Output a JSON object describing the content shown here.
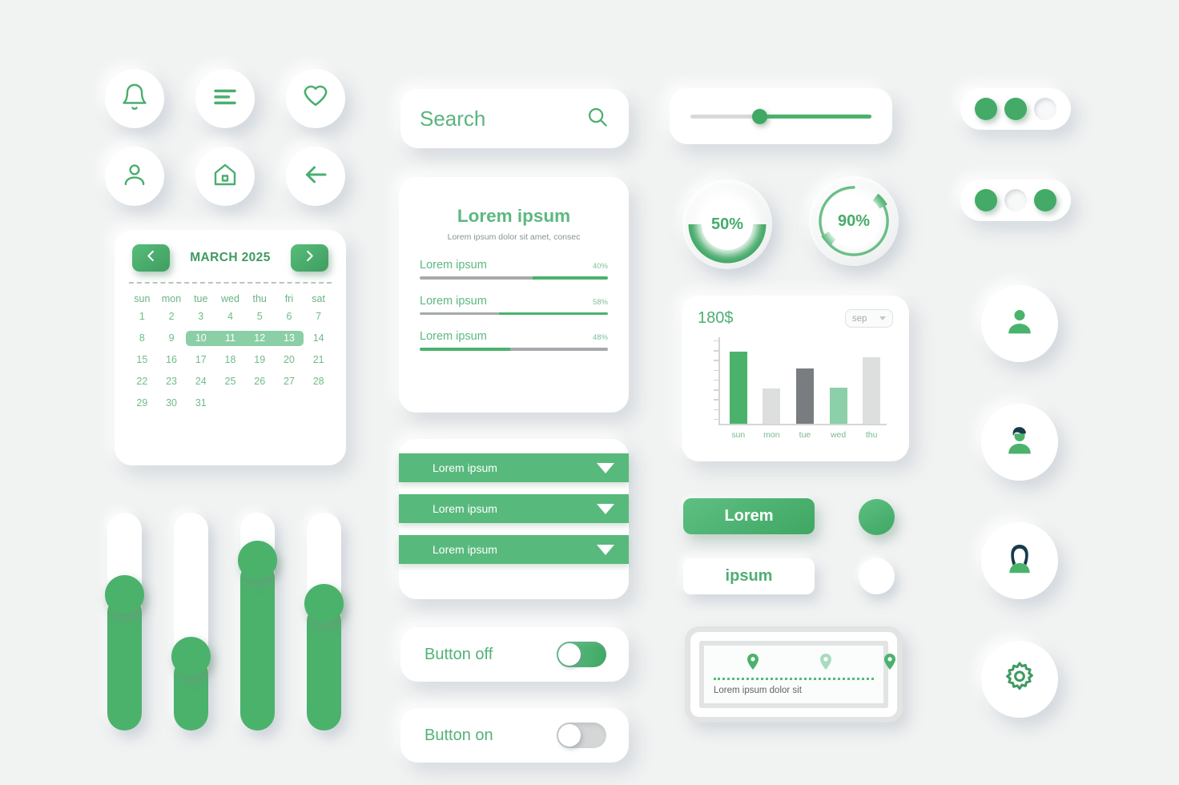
{
  "theme": {
    "background": "#f1f2f2",
    "green": "#4bb26c",
    "green_dark": "#3fa662",
    "green_light": "#8bcfa6",
    "gray": "#a7a9ac",
    "gray_dark": "#7a7d80",
    "gray_light": "#dddede",
    "text_green": "#53b277"
  },
  "icon_buttons": [
    {
      "name": "bell-icon",
      "label": "Notifications"
    },
    {
      "name": "menu-icon",
      "label": "Menu"
    },
    {
      "name": "heart-icon",
      "label": "Favorites"
    },
    {
      "name": "user-icon",
      "label": "Profile"
    },
    {
      "name": "home-icon",
      "label": "Home"
    },
    {
      "name": "back-arrow-icon",
      "label": "Back"
    }
  ],
  "calendar": {
    "title": "MARCH 2025",
    "prev_label": "<",
    "next_label": ">",
    "day_names": [
      "sun",
      "mon",
      "tue",
      "wed",
      "thu",
      "fri",
      "sat"
    ],
    "weeks": [
      [
        "1",
        "2",
        "3",
        "4",
        "5",
        "6",
        "7"
      ],
      [
        "8",
        "9",
        "10",
        "11",
        "12",
        "13",
        "14"
      ],
      [
        "15",
        "16",
        "17",
        "18",
        "19",
        "20",
        "21"
      ],
      [
        "22",
        "23",
        "24",
        "25",
        "26",
        "27",
        "28"
      ],
      [
        "29",
        "30",
        "31",
        "",
        "",
        "",
        ""
      ]
    ],
    "selected_range": [
      "10",
      "11",
      "12",
      "13"
    ],
    "selected_row_index": 1,
    "selected_col_start": 2,
    "selected_col_end": 5
  },
  "vertical_sliders": [
    {
      "name": "slider-1",
      "value": 62
    },
    {
      "name": "slider-2",
      "value": 34
    },
    {
      "name": "slider-3",
      "value": 78
    },
    {
      "name": "slider-4",
      "value": 58
    }
  ],
  "search": {
    "placeholder": "Search",
    "value": "Search",
    "icon": "search-icon"
  },
  "stats_card": {
    "title": "Lorem ipsum",
    "subtitle": "Lorem ipsum dolor sit amet, consec",
    "items": [
      {
        "label": "Lorem ipsum",
        "percent": "40%",
        "value": 40,
        "fill_from": "right"
      },
      {
        "label": "Lorem ipsum",
        "percent": "58%",
        "value": 58,
        "fill_from": "right"
      },
      {
        "label": "Lorem ipsum",
        "percent": "48%",
        "value": 48,
        "fill_from": "left"
      }
    ]
  },
  "dropdowns": [
    {
      "label": "Lorem ipsum",
      "icon": "chevron-down-icon"
    },
    {
      "label": "Lorem ipsum",
      "icon": "chevron-down-icon"
    },
    {
      "label": "Lorem ipsum",
      "icon": "chevron-down-icon"
    }
  ],
  "toggles": [
    {
      "label": "Button off",
      "state": "on"
    },
    {
      "label": "Button on",
      "state": "off"
    }
  ],
  "horizontal_slider": {
    "value": 38
  },
  "gauges": [
    {
      "name": "gauge-50",
      "label": "50%",
      "value": 50,
      "style": "thick-arc"
    },
    {
      "name": "gauge-90",
      "label": "90%",
      "value": 90,
      "style": "thin-ring-segments"
    }
  ],
  "chart_card": {
    "amount": "180$",
    "period_selected": "sep",
    "period_icon": "chevron-down-icon"
  },
  "chart_data": {
    "type": "bar",
    "title": "180$",
    "categories": [
      "sun",
      "mon",
      "tue",
      "wed",
      "thu"
    ],
    "values": [
      83,
      41,
      64,
      42,
      77
    ],
    "colors": [
      "#4bb26c",
      "#dddede",
      "#7a7d80",
      "#8bd0a8",
      "#dddede"
    ],
    "xlabel": "",
    "ylabel": "",
    "ylim": [
      0,
      100
    ],
    "grid": false,
    "legend": false,
    "y_tick_count": 9
  },
  "action_buttons": {
    "primary_label": "Lorem",
    "secondary_label": "ipsum"
  },
  "map_card": {
    "caption": "Lorem ipsum dolor sit",
    "pins": [
      {
        "name": "map-pin-1",
        "state": "active"
      },
      {
        "name": "map-pin-2",
        "state": "muted"
      },
      {
        "name": "map-pin-3",
        "state": "active"
      }
    ]
  },
  "pagination": [
    {
      "name": "pagination-top",
      "dots": [
        "on",
        "on",
        "off"
      ]
    },
    {
      "name": "pagination-bottom",
      "dots": [
        "on",
        "off",
        "on"
      ]
    }
  ],
  "avatars": [
    {
      "name": "avatar-user-generic"
    },
    {
      "name": "avatar-user-male"
    },
    {
      "name": "avatar-user-female"
    },
    {
      "name": "gear-icon"
    }
  ]
}
